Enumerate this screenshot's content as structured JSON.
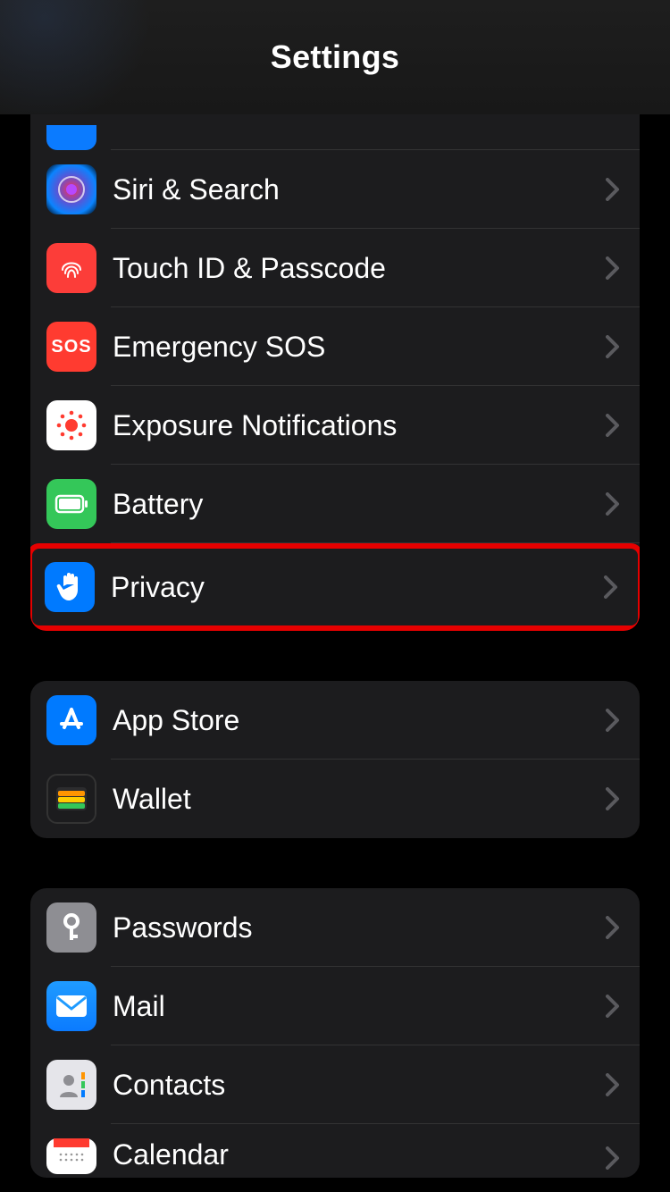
{
  "header": {
    "title": "Settings"
  },
  "groups": [
    {
      "id": "g1",
      "items": [
        {
          "id": "partial-top",
          "label": "",
          "icon": "unknown-icon"
        },
        {
          "id": "siri",
          "label": "Siri & Search",
          "icon": "siri-icon"
        },
        {
          "id": "touchid",
          "label": "Touch ID & Passcode",
          "icon": "fingerprint-icon"
        },
        {
          "id": "sos",
          "label": "Emergency SOS",
          "icon": "sos-icon"
        },
        {
          "id": "exposure",
          "label": "Exposure Notifications",
          "icon": "exposure-icon"
        },
        {
          "id": "battery",
          "label": "Battery",
          "icon": "battery-icon"
        },
        {
          "id": "privacy",
          "label": "Privacy",
          "icon": "hand-icon",
          "highlighted": true
        }
      ]
    },
    {
      "id": "g2",
      "items": [
        {
          "id": "appstore",
          "label": "App Store",
          "icon": "appstore-icon"
        },
        {
          "id": "wallet",
          "label": "Wallet",
          "icon": "wallet-icon"
        }
      ]
    },
    {
      "id": "g3",
      "items": [
        {
          "id": "passwords",
          "label": "Passwords",
          "icon": "key-icon"
        },
        {
          "id": "mail",
          "label": "Mail",
          "icon": "mail-icon"
        },
        {
          "id": "contacts",
          "label": "Contacts",
          "icon": "contacts-icon"
        },
        {
          "id": "calendar",
          "label": "Calendar",
          "icon": "calendar-icon"
        }
      ]
    }
  ],
  "colors": {
    "highlight": "#e60000",
    "background": "#000000",
    "card": "#1c1c1e"
  }
}
